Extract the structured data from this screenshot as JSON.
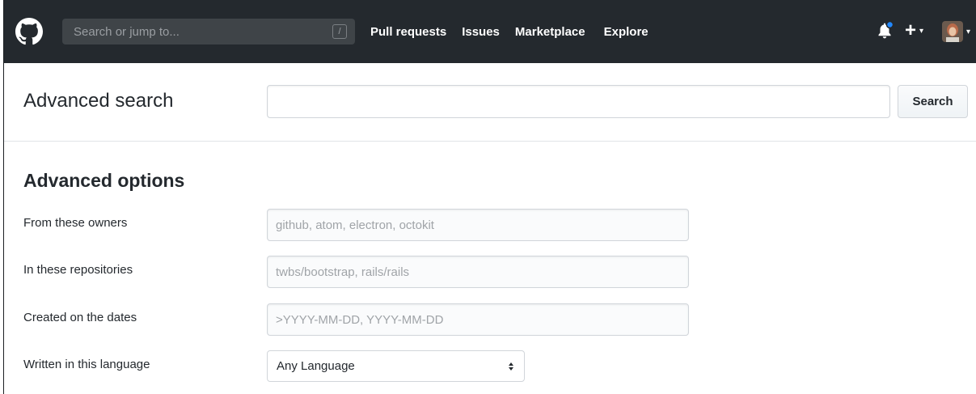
{
  "header": {
    "search": {
      "placeholder": "Search or jump to...",
      "shortcut": "/"
    },
    "nav": [
      {
        "label": "Pull requests"
      },
      {
        "label": "Issues"
      },
      {
        "label": "Marketplace"
      },
      {
        "label": "Explore"
      }
    ],
    "icons": {
      "logo": "github-logo-icon",
      "notifications": "bell-icon",
      "create": "plus-icon",
      "user": "avatar"
    },
    "colors": {
      "header_bg": "#24292e",
      "search_bg": "#3f4448",
      "notification_dot": "#2188ff"
    }
  },
  "advanced_search": {
    "title": "Advanced search",
    "query_value": "",
    "search_button_label": "Search"
  },
  "advanced_options": {
    "heading": "Advanced options",
    "fields": [
      {
        "label": "From these owners",
        "placeholder": "github, atom, electron, octokit",
        "value": ""
      },
      {
        "label": "In these repositories",
        "placeholder": "twbs/bootstrap, rails/rails",
        "value": ""
      },
      {
        "label": "Created on the dates",
        "placeholder": ">YYYY-MM-DD, YYYY-MM-DD",
        "value": ""
      }
    ],
    "language": {
      "label": "Written in this language",
      "selected": "Any Language"
    }
  }
}
